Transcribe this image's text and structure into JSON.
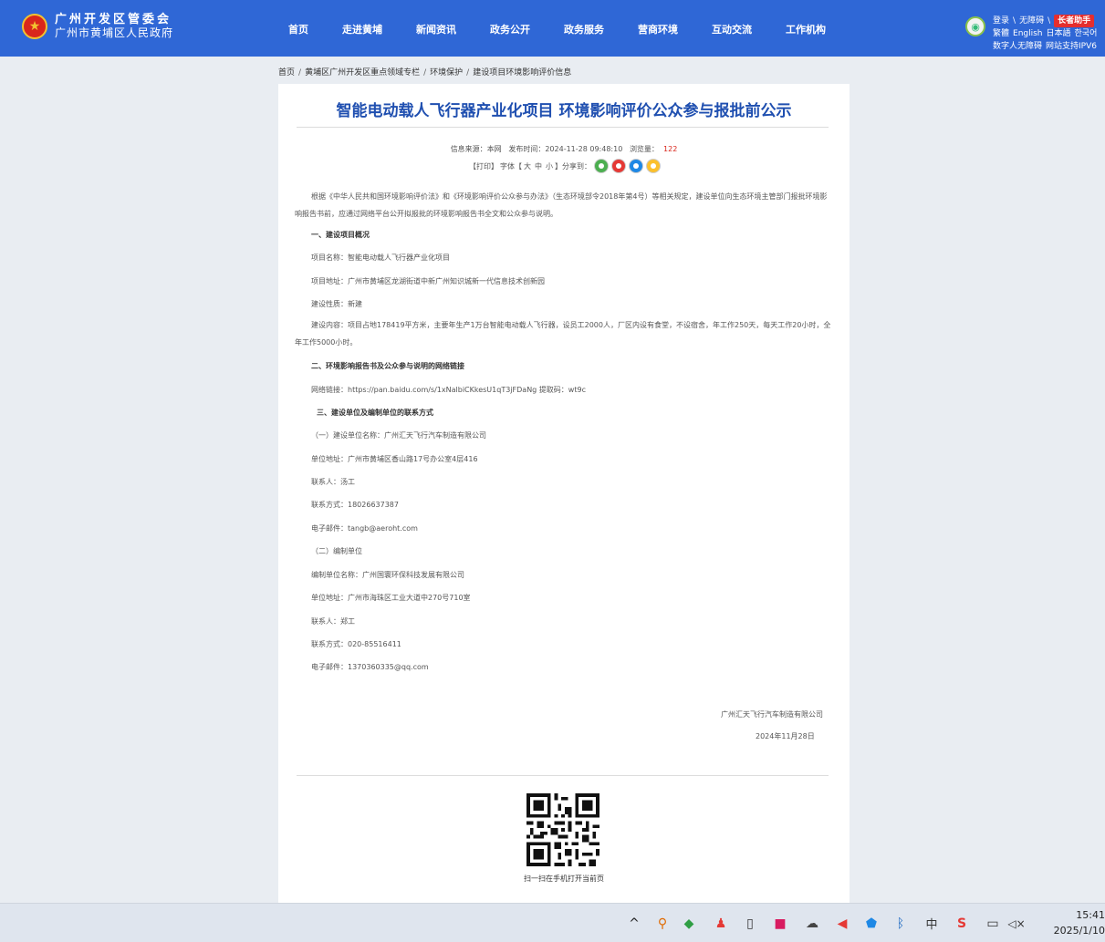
{
  "header": {
    "title_line1": "广州开发区管委会",
    "title_line2": "广州市黄埔区人民政府",
    "nav": [
      "首页",
      "走进黄埔",
      "新闻资讯",
      "政务公开",
      "政务服务",
      "营商环境",
      "互动交流",
      "工作机构"
    ],
    "util": {
      "login": "登录",
      "register": "无障碍",
      "elder": "长者助手",
      "traditional": "繁體",
      "english": "English",
      "japanese": "日本語",
      "korean": "한국어",
      "digital_person": "数字人无障碍",
      "ipv6": "网站支持IPV6"
    }
  },
  "breadcrumb": [
    "首页",
    "黄埔区广州开发区重点领域专栏",
    "环境保护",
    "建设项目环境影响评价信息"
  ],
  "article": {
    "title": "智能电动载人飞行器产业化项目 环境影响评价公众参与报批前公示",
    "meta": {
      "source_label": "信息来源：",
      "source": "本网",
      "time_label": "发布时间：",
      "time": "2024-11-28 09:48:10",
      "views_label": "浏览量：",
      "views": "122"
    },
    "tools": {
      "print": "【打印】",
      "font_label": "字体【",
      "font_large": "大",
      "font_medium": "中",
      "font_small": "小",
      "font_end": "】",
      "share_label": "分享到："
    },
    "intro": "根据《中华人民共和国环境影响评价法》和《环境影响评价公众参与办法》（生态环境部令2018年第4号）等相关规定，建设单位向生态环境主管部门报批环境影响报告书前，应通过网络平台公开拟报批的环境影响报告书全文和公众参与说明。",
    "section1_heading": "一、建设项目概况",
    "project_name": "项目名称：智能电动载人飞行器产业化项目",
    "project_address": "项目地址：广州市黄埔区龙湖街道中新广州知识城新一代信息技术创新园",
    "project_nature": "建设性质：新建",
    "project_content": "建设内容：项目占地178419平方米，主要年生产1万台智能电动载人飞行器，设员工2000人，厂区内设有食堂，不设宿舍，年工作250天，每天工作20小时，全年工作5000小时。",
    "section2_heading": "二、环境影响报告书及公众参与说明的网络链接",
    "network_link": "网络链接：https://pan.baidu.com/s/1xNalbiCKkesU1qT3jFDaNg 提取码：wt9c",
    "section3_heading": "三、建设单位及编制单位的联系方式",
    "sub1": "（一）建设单位名称：广州汇天飞行汽车制造有限公司",
    "unit1_address": "单位地址：广州市黄埔区香山路17号办公室4层416",
    "unit1_contact": "联系人：汤工",
    "unit1_phone": "联系方式：18026637387",
    "unit1_email": "电子邮件：tangb@aeroht.com",
    "sub2": "（二）编制单位",
    "unit2_name": "编制单位名称：广州国寰环保科技发展有限公司",
    "unit2_address": "单位地址：广州市海珠区工业大道中270号710室",
    "unit2_contact": "联系人：郑工",
    "unit2_phone": "联系方式：020-85516411",
    "unit2_email": "电子邮件：1370360335@qq.com",
    "sign_company": "广州汇天飞行汽车制造有限公司",
    "sign_date": "2024年11月28日"
  },
  "qr_caption": "扫一扫在手机打开当前页",
  "taskbar": {
    "ime": "中",
    "time": "15:41",
    "date": "2025/1/10"
  }
}
